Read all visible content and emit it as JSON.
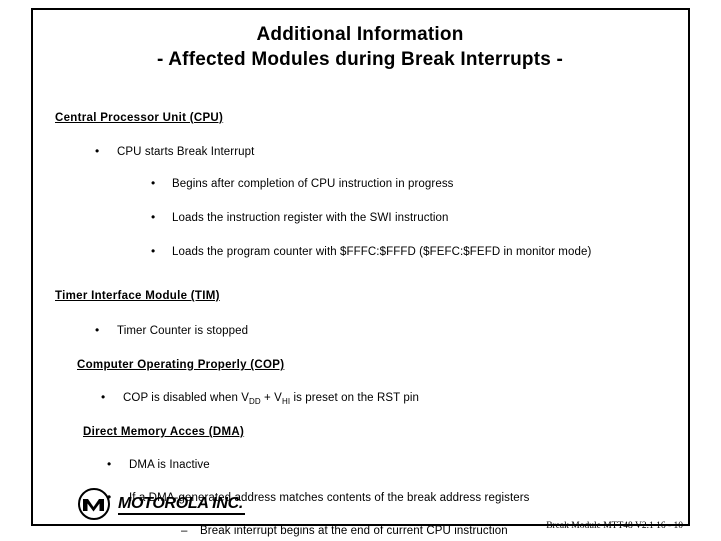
{
  "slide": {
    "title_line1": "Additional Information",
    "title_line2": "- Affected Modules during Break Interrupts -",
    "sections": [
      {
        "heading": "Central Processor Unit (CPU)",
        "bullets": [
          {
            "level": 1,
            "text": "CPU starts Break Interrupt"
          },
          {
            "level": 2,
            "text": "Begins after completion of CPU instruction in progress"
          },
          {
            "level": 2,
            "text": "Loads the instruction register with the SWI instruction"
          },
          {
            "level": 2,
            "text": "Loads the program counter with $FFFC:$FFFD ($FEFC:$FEFD in monitor mode)"
          }
        ]
      },
      {
        "heading": "Timer Interface Module  (TIM)",
        "bullets": [
          {
            "level": 1,
            "text": "Timer Counter is stopped"
          }
        ]
      },
      {
        "heading": "Computer Operating Properly (COP)",
        "bullets": [
          {
            "level": 1,
            "text": "COP is disabled when V",
            "sub1": "DD",
            "text2": " + V",
            "sub2": "HI",
            "text3": " is preset on the RST pin"
          }
        ]
      },
      {
        "heading": "Direct Memory Acces (DMA)",
        "bullets": [
          {
            "level": 1,
            "text": "DMA is Inactive"
          },
          {
            "level": 1,
            "text": "If a DMA-generated address matches contents of the break address registers"
          },
          {
            "level": 3,
            "text": "Break interrupt begins at the end of current CPU instruction"
          }
        ]
      }
    ],
    "logo_text": "MOTOROLA INC.",
    "footer": "Break Module MTT48  V2.1  16 -  10"
  }
}
